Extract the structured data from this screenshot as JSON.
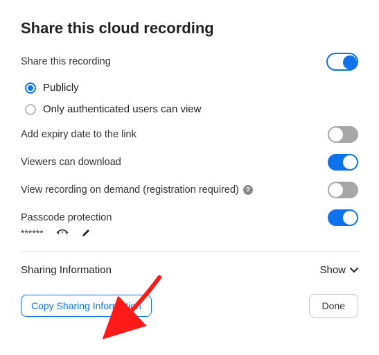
{
  "title": "Share this cloud recording",
  "share_label": "Share this recording",
  "share_enabled": true,
  "options": {
    "public_label": "Publicly",
    "auth_label": "Only authenticated users can view",
    "selected": "public"
  },
  "expiry": {
    "label": "Add expiry date to the link",
    "enabled": false
  },
  "download": {
    "label": "Viewers can download",
    "enabled": true
  },
  "on_demand": {
    "label": "View recording on demand (registration required)",
    "enabled": false
  },
  "passcode": {
    "label": "Passcode protection",
    "enabled": true,
    "value_masked": "******"
  },
  "sharing_info": {
    "label": "Sharing Information",
    "toggle_label": "Show"
  },
  "buttons": {
    "copy": "Copy Sharing Information",
    "done": "Done"
  }
}
